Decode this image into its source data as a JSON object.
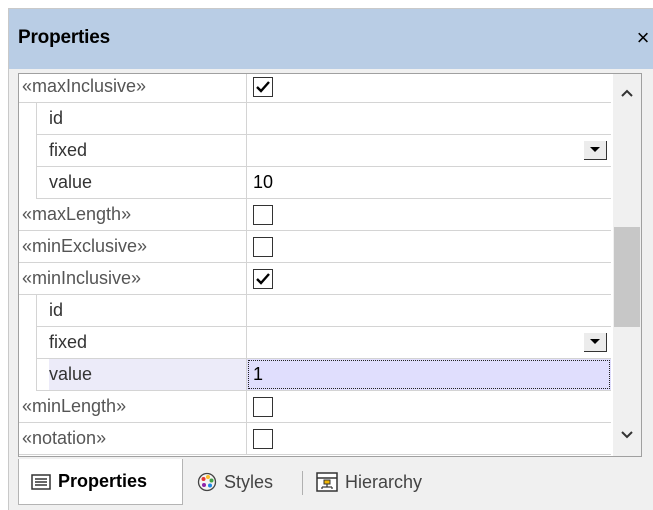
{
  "window": {
    "title": "Properties",
    "close_glyph": "×"
  },
  "grid": {
    "rows": [
      {
        "label": "«maxInclusive»",
        "level": 0,
        "kind": "checkbox",
        "checked": true
      },
      {
        "label": "id",
        "level": 1,
        "kind": "text",
        "value": ""
      },
      {
        "label": "fixed",
        "level": 1,
        "kind": "dropdown",
        "value": ""
      },
      {
        "label": "value",
        "level": 1,
        "kind": "text",
        "value": "10"
      },
      {
        "label": "«maxLength»",
        "level": 0,
        "kind": "checkbox",
        "checked": false
      },
      {
        "label": "«minExclusive»",
        "level": 0,
        "kind": "checkbox",
        "checked": false
      },
      {
        "label": "«minInclusive»",
        "level": 0,
        "kind": "checkbox",
        "checked": true
      },
      {
        "label": "id",
        "level": 1,
        "kind": "text",
        "value": ""
      },
      {
        "label": "fixed",
        "level": 1,
        "kind": "dropdown",
        "value": ""
      },
      {
        "label": "value",
        "level": 1,
        "kind": "text",
        "value": "1",
        "selected": true
      },
      {
        "label": "«minLength»",
        "level": 0,
        "kind": "checkbox",
        "checked": false
      },
      {
        "label": "«notation»",
        "level": 0,
        "kind": "checkbox",
        "checked": false
      }
    ]
  },
  "tabs": {
    "properties": {
      "label": "Properties",
      "icon": "properties-icon",
      "active": true
    },
    "styles": {
      "label": "Styles",
      "icon": "palette-icon",
      "active": false
    },
    "hierarchy": {
      "label": "Hierarchy",
      "icon": "hierarchy-icon",
      "active": false
    }
  },
  "colors": {
    "titlebar": "#b9cde5",
    "selected_value": "#e0defd",
    "panel": "#f0f0f0"
  }
}
